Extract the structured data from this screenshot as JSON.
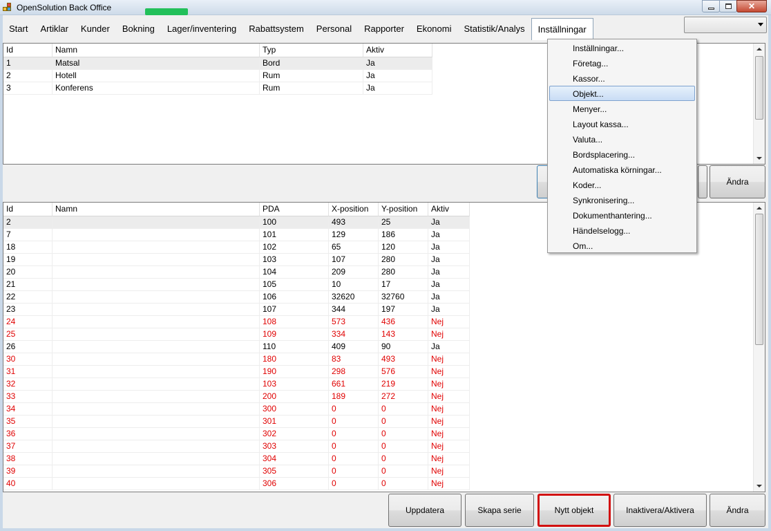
{
  "window": {
    "title": "OpenSolution Back Office"
  },
  "tabs": [
    "Start",
    "Artiklar",
    "Kunder",
    "Bokning",
    "Lager/inventering",
    "Rabattsystem",
    "Personal",
    "Rapporter",
    "Ekonomi",
    "Statistik/Analys",
    "Inställningar"
  ],
  "active_tab": "Inställningar",
  "top_grid": {
    "columns": [
      "Id",
      "Namn",
      "Typ",
      "Aktiv"
    ],
    "rows": [
      [
        "1",
        "Matsal",
        "Bord",
        "Ja"
      ],
      [
        "2",
        "Hotell",
        "Rum",
        "Ja"
      ],
      [
        "3",
        "Konferens",
        "Rum",
        "Ja"
      ]
    ],
    "selected_row": 0
  },
  "bottom_grid": {
    "columns": [
      "Id",
      "Namn",
      "PDA",
      "X-position",
      "Y-position",
      "Aktiv"
    ],
    "rows": [
      [
        "2",
        "",
        "100",
        "493",
        "25",
        "Ja"
      ],
      [
        "7",
        "",
        "101",
        "129",
        "186",
        "Ja"
      ],
      [
        "18",
        "",
        "102",
        "65",
        "120",
        "Ja"
      ],
      [
        "19",
        "",
        "103",
        "107",
        "280",
        "Ja"
      ],
      [
        "20",
        "",
        "104",
        "209",
        "280",
        "Ja"
      ],
      [
        "21",
        "",
        "105",
        "10",
        "17",
        "Ja"
      ],
      [
        "22",
        "",
        "106",
        "32620",
        "32760",
        "Ja"
      ],
      [
        "23",
        "",
        "107",
        "344",
        "197",
        "Ja"
      ],
      [
        "24",
        "",
        "108",
        "573",
        "436",
        "Nej"
      ],
      [
        "25",
        "",
        "109",
        "334",
        "143",
        "Nej"
      ],
      [
        "26",
        "",
        "110",
        "409",
        "90",
        "Ja"
      ],
      [
        "30",
        "",
        "180",
        "83",
        "493",
        "Nej"
      ],
      [
        "31",
        "",
        "190",
        "298",
        "576",
        "Nej"
      ],
      [
        "32",
        "",
        "103",
        "661",
        "219",
        "Nej"
      ],
      [
        "33",
        "",
        "200",
        "189",
        "272",
        "Nej"
      ],
      [
        "34",
        "",
        "300",
        "0",
        "0",
        "Nej"
      ],
      [
        "35",
        "",
        "301",
        "0",
        "0",
        "Nej"
      ],
      [
        "36",
        "",
        "302",
        "0",
        "0",
        "Nej"
      ],
      [
        "37",
        "",
        "303",
        "0",
        "0",
        "Nej"
      ],
      [
        "38",
        "",
        "304",
        "0",
        "0",
        "Nej"
      ],
      [
        "39",
        "",
        "305",
        "0",
        "0",
        "Nej"
      ],
      [
        "40",
        "",
        "306",
        "0",
        "0",
        "Nej"
      ]
    ],
    "selected_row": 0
  },
  "buttons": {
    "top_andra": "Ändra",
    "uppdatera": "Uppdatera",
    "skapa_serie": "Skapa serie",
    "nytt_objekt": "Nytt objekt",
    "inaktivera": "Inaktivera/Aktivera",
    "andra": "Ändra"
  },
  "settings_menu": {
    "items": [
      "Inställningar...",
      "Företag...",
      "Kassor...",
      "Objekt...",
      "Menyer...",
      "Layout kassa...",
      "Valuta...",
      "Bordsplacering...",
      "Automatiska körningar...",
      "Koder...",
      "Synkronisering...",
      "Dokumenthantering...",
      "Händelselogg...",
      "Om..."
    ],
    "highlighted": 3
  },
  "colors": {
    "inactive_text": "#e00000",
    "highlight_border": "#d21010",
    "menu_highlight": "#c9ddf5"
  }
}
